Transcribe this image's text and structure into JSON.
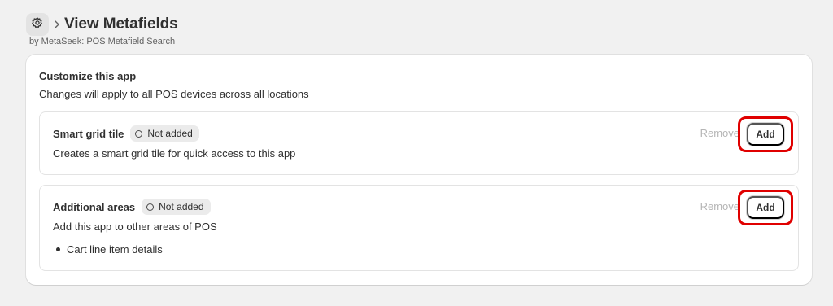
{
  "header": {
    "title": "View Metafields",
    "subtitle": "by MetaSeek: POS Metafield Search"
  },
  "card": {
    "title": "Customize this app",
    "description": "Changes will apply to all POS devices across all locations"
  },
  "sections": [
    {
      "title": "Smart grid tile",
      "badge": "Not added",
      "description": "Creates a smart grid tile for quick access to this app",
      "remove_label": "Remove",
      "add_label": "Add"
    },
    {
      "title": "Additional areas",
      "badge": "Not added",
      "description": "Add this app to other areas of POS",
      "list": [
        "Cart line item details"
      ],
      "remove_label": "Remove",
      "add_label": "Add"
    }
  ],
  "colors": {
    "highlight": "#e00000",
    "background": "#f1f1f1"
  }
}
